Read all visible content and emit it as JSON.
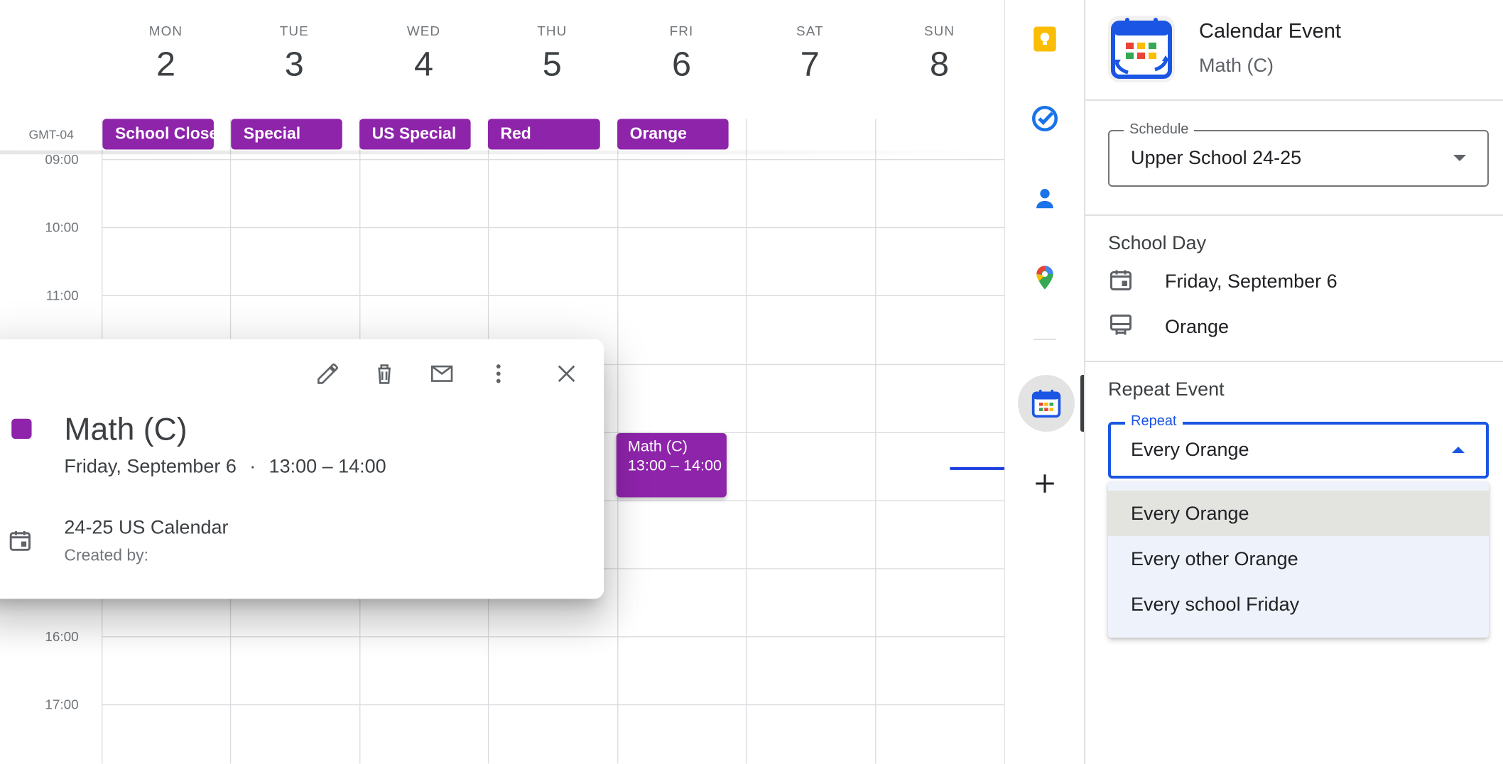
{
  "calendar": {
    "days": [
      {
        "name": "MON",
        "num": "2"
      },
      {
        "name": "TUE",
        "num": "3"
      },
      {
        "name": "WED",
        "num": "4"
      },
      {
        "name": "THU",
        "num": "5"
      },
      {
        "name": "FRI",
        "num": "6"
      },
      {
        "name": "SAT",
        "num": "7"
      },
      {
        "name": "SUN",
        "num": "8"
      }
    ],
    "allday_events": [
      "School Closed",
      "Special",
      "US Special",
      "Red",
      "Orange"
    ],
    "timezone": "GMT-04",
    "hours": [
      "09:00",
      "10:00",
      "11:00",
      "16:00",
      "17:00"
    ],
    "event_chip": {
      "title": "Math (C)",
      "time": "13:00 – 14:00"
    }
  },
  "popup": {
    "color": "#8e24aa",
    "title": "Math (C)",
    "date": "Friday, September 6",
    "separator": "·",
    "time": "13:00 – 14:00",
    "calendar_name": "24-25 US Calendar",
    "created_by": "Created by:",
    "icons": [
      "pencil-icon",
      "trash-icon",
      "email-icon",
      "more-vert-icon",
      "close-icon"
    ]
  },
  "rail": {
    "icons": [
      "keep-icon",
      "tasks-icon",
      "contacts-icon",
      "maps-icon",
      "calendar-addon-icon",
      "plus-icon"
    ]
  },
  "panel": {
    "title": "Calendar Event",
    "subtitle": "Math (C)",
    "schedule": {
      "label": "Schedule",
      "value": "Upper School 24-25"
    },
    "school_day": {
      "heading": "School Day",
      "date": "Friday, September 6",
      "rotation": "Orange"
    },
    "repeat": {
      "heading": "Repeat Event",
      "label": "Repeat",
      "value": "Every Orange",
      "options": [
        "Every Orange",
        "Every other Orange",
        "Every school Friday"
      ]
    }
  },
  "colors": {
    "event_purple": "#8e24aa",
    "focus_blue": "#1a55e3"
  }
}
